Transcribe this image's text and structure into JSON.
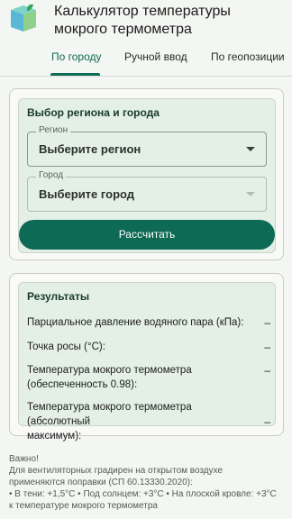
{
  "header": {
    "title_line1": "Калькулятор температуры",
    "title_line2": "мокрого термометра",
    "logo_icon": "thermometer-cube-icon"
  },
  "tabs": [
    {
      "label": "По городу",
      "active": true
    },
    {
      "label": "Ручной ввод",
      "active": false
    },
    {
      "label": "По геопозиции",
      "active": false
    }
  ],
  "location": {
    "section_title": "Выбор региона и города",
    "region": {
      "label": "Регион",
      "value": "Выберите регион"
    },
    "city": {
      "label": "Город",
      "value": "Выберите город"
    },
    "calculate_label": "Рассчитать"
  },
  "results": {
    "title": "Результаты",
    "rows": [
      {
        "label_line1": "Парциальное давление водяного пара (кПа):",
        "label_line2": "",
        "value": "–"
      },
      {
        "label_line1": "Точка росы (°C):",
        "label_line2": "",
        "value": "–"
      },
      {
        "label_line1": "Температура мокрого термометра",
        "label_line2": "(обеспеченность 0.98):",
        "value": "–"
      },
      {
        "label_line1": "Температура мокрого термометра (абсолютный",
        "label_line2": "максимум):",
        "value": "–"
      }
    ]
  },
  "note": {
    "line1": "Важно!",
    "line2": "Для вентиляторных градирен на открытом воздухе",
    "line3": "применяются поправки (СП 60.13330.2020):",
    "line4": "• В тени: +1,5°C • Под солнцем: +3°C • На плоской кровле: +3°C",
    "line5": "к температуре мокрого термометра"
  },
  "colors": {
    "accent": "#0d6a55",
    "panel": "#e4f0e6",
    "background": "#f4f6f3"
  }
}
